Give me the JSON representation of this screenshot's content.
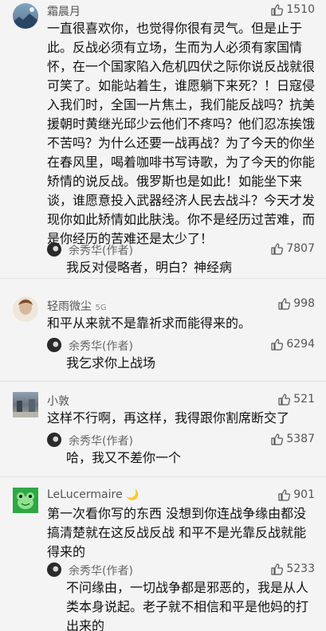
{
  "comments": [
    {
      "user": "霜晨月",
      "likes": "1510",
      "text": "一直很喜欢你，也觉得你很有灵气。但是止于此。反战必须有立场，生而为人必须有家国情怀，在一个国家陷入危机四伏之际你说反战就很可笑了。如能站着生，谁愿躺下来死？！日寇侵入我们时，全国一片焦土，我们能反战吗？抗美援朝时黄继光邱少云他们不疼吗？他们忍冻挨饿不苦吗？为什么还要一战再战？为了今天的你坐在春风里，喝着咖啡书写诗歌，为了今天的你能矫情的说反战。俄罗斯也是如此！如能坐下来谈，谁愿意投入武器经济人民去战斗？今天才发现你如此矫情如此肤浅。你不是经历过苦难，而是你经历的苦难还是太少了！",
      "reply": {
        "user": "余秀华(作者)",
        "likes": "7807",
        "text": "我反对侵略者，明白？神经病"
      }
    },
    {
      "user": "轻雨微尘",
      "badge": "5G",
      "likes": "998",
      "text": "和平从来就不是靠祈求而能得来的。",
      "reply": {
        "user": "余秀华(作者)",
        "likes": "6294",
        "text": "我乞求你上战场"
      }
    },
    {
      "user": "小敦",
      "likes": "521",
      "text": "这样不行啊，再这样，我得跟你割席断交了",
      "reply": {
        "user": "余秀华(作者)",
        "likes": "5387",
        "text": "哈，我又不差你一个"
      }
    },
    {
      "user": "LeLucermaire",
      "badge": "🌙",
      "likes": "901",
      "text": "第一次看你写的东西 没想到你连战争缘由都没搞清楚就在这反战反战 和平不是光靠反战就能得来的",
      "reply": {
        "user": "余秀华(作者)",
        "likes": "5233",
        "text": "不问缘由，一切战争都是邪恶的，我是从人类本身说起。老子就不相信和平是他妈的打出来的"
      }
    }
  ],
  "colors": {
    "background": "#f4f4f4",
    "text": "#111111",
    "username": "#555555",
    "like": "#555555"
  },
  "icons": [
    "thumbs-up-icon",
    "avatar",
    "author-avatar"
  ]
}
